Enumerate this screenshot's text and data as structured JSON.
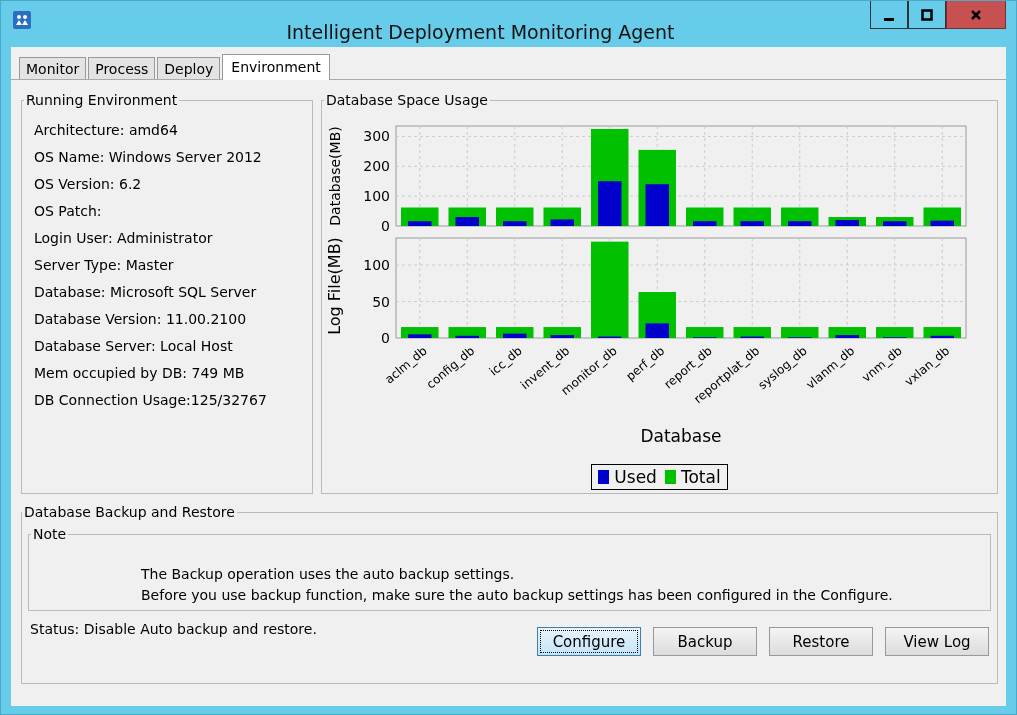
{
  "window": {
    "title": "Intelligent Deployment Monitoring Agent"
  },
  "tabs": [
    {
      "label": "Monitor",
      "selected": false
    },
    {
      "label": "Process",
      "selected": false
    },
    {
      "label": "Deploy",
      "selected": false
    },
    {
      "label": "Environment",
      "selected": true
    }
  ],
  "running_environment": {
    "title": "Running Environment",
    "lines": [
      "Architecture: amd64",
      "OS Name: Windows Server 2012",
      "OS Version: 6.2",
      "OS Patch:",
      "Login User: Administrator",
      "Server Type: Master",
      "Database: Microsoft SQL Server",
      "Database Version: 11.00.2100",
      "Database Server: Local Host",
      "Mem occupied by DB: 749 MB",
      "DB Connection Usage:125/32767"
    ]
  },
  "space_usage": {
    "title": "Database Space Usage",
    "charts": [
      {
        "chart_data": {
          "type": "bar",
          "ylabel": "Database(MB)",
          "grid": true,
          "ylim": [
            0,
            335
          ],
          "yticks": [
            0,
            100,
            200,
            300
          ],
          "series": [
            {
              "color": "#0000cc",
              "values": [
                16,
                30,
                16,
                22,
                150,
                140,
                16,
                16,
                16,
                20,
                16,
                18
              ]
            },
            {
              "color": "#00c000",
              "values": [
                62,
                62,
                62,
                62,
                325,
                255,
                62,
                62,
                62,
                30,
                30,
                62
              ]
            }
          ]
        }
      },
      {
        "chart_data": {
          "type": "bar",
          "xlabel": "Database",
          "ylabel": "Log File(MB)",
          "grid": true,
          "categories": [
            "aclm_db",
            "config_db",
            "icc_db",
            "invent_db",
            "monitor_db",
            "perf_db",
            "report_db",
            "reportplat_db",
            "syslog_db",
            "vlanm_db",
            "vnm_db",
            "vxlan_db"
          ],
          "ylim": [
            0,
            137
          ],
          "yticks": [
            0,
            50,
            100
          ],
          "series": [
            {
              "name": "Used",
              "color": "#0000cc",
              "values": [
                5,
                3,
                6,
                4,
                2,
                20,
                1,
                2,
                1,
                4,
                1,
                3
              ]
            },
            {
              "name": "Total",
              "color": "#00c000",
              "values": [
                15,
                15,
                15,
                15,
                132,
                63,
                15,
                15,
                15,
                15,
                15,
                15
              ]
            }
          ]
        }
      }
    ]
  },
  "backup": {
    "title": "Database Backup and Restore",
    "note": {
      "title": "Note",
      "lines": [
        "The Backup operation uses the auto backup settings.",
        "Before you use backup function, make sure the auto backup settings has been configured in the Configure."
      ]
    },
    "status": "Status: Disable Auto backup and restore.",
    "buttons": [
      {
        "label": "Configure",
        "focused": true
      },
      {
        "label": "Backup",
        "focused": false
      },
      {
        "label": "Restore",
        "focused": false
      },
      {
        "label": "View Log",
        "focused": false
      }
    ]
  }
}
